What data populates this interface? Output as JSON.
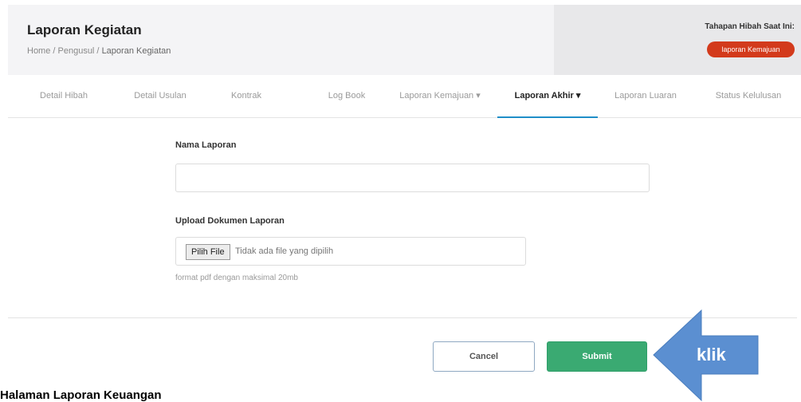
{
  "header": {
    "title": "Laporan Kegiatan",
    "breadcrumb": {
      "prefix": "Home / Pengusul / ",
      "current": "Laporan Kegiatan"
    },
    "stage": {
      "label": "Tahapan Hibah Saat Ini:",
      "badge": "laporan Kemajuan"
    }
  },
  "tabs": [
    {
      "label": "Detail Hibah"
    },
    {
      "label": "Detail Usulan"
    },
    {
      "label": "Kontrak"
    },
    {
      "label": "Log Book"
    },
    {
      "label": "Laporan Kemajuan ▾"
    },
    {
      "label": "Laporan Akhir ▾"
    },
    {
      "label": "Laporan Luaran"
    },
    {
      "label": "Status Kelulusan"
    }
  ],
  "active_tab": "Laporan Akhir",
  "form": {
    "name_label": "Nama Laporan",
    "name_value": "",
    "upload_label": "Upload Dokumen Laporan",
    "file_button": "Pilih File",
    "file_status": "Tidak ada file yang dipilih",
    "help_text": "format pdf dengan maksimal 20mb"
  },
  "actions": {
    "cancel": "Cancel",
    "submit": "Submit"
  },
  "annotation": {
    "arrow_text": "klik",
    "arrow_color": "#5b8fd1"
  },
  "caption": "Halaman Laporan Keuangan",
  "colors": {
    "badge": "#d33a1c",
    "active_tab_underline": "#1f8ec8",
    "submit": "#3aaa72"
  }
}
